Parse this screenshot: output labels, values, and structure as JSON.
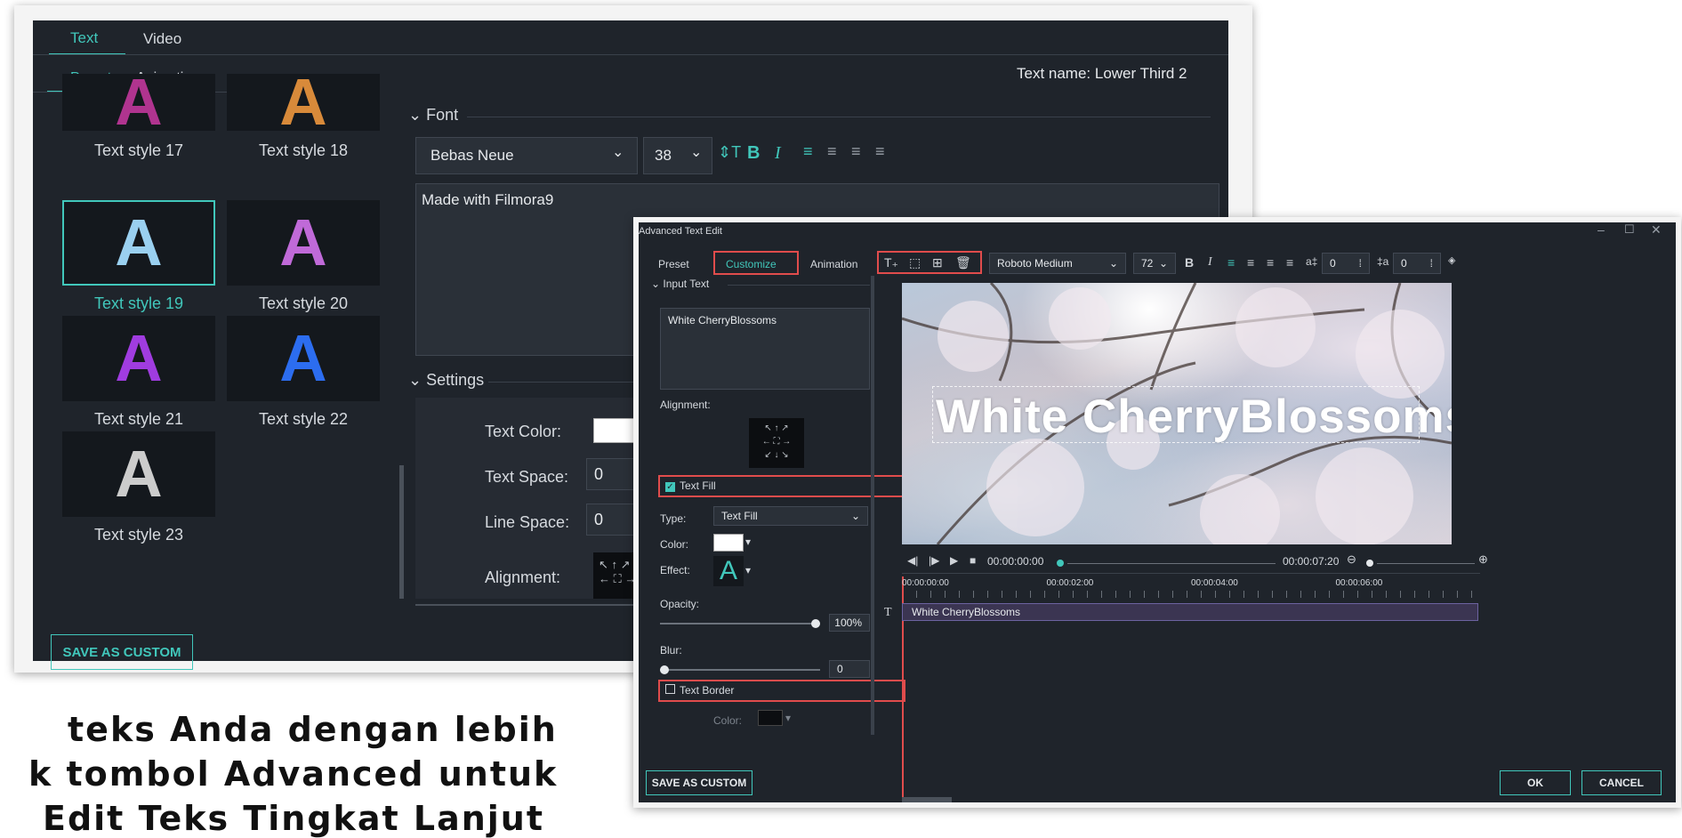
{
  "panel1": {
    "tabs": [
      "Text",
      "Video"
    ],
    "subtabs": [
      "Preset",
      "Animation"
    ],
    "text_name": "Text name: Lower Third 2",
    "styles": [
      {
        "label": "Text style 17",
        "color": "#b0348f"
      },
      {
        "label": "Text style 18",
        "color": "#d88a3a"
      },
      {
        "label": "Text style 19",
        "color": "#9ad0f0",
        "selected": true
      },
      {
        "label": "Text style 20",
        "color": "#c06ad8"
      },
      {
        "label": "Text style 21",
        "color": "#a03ce0"
      },
      {
        "label": "Text style 22",
        "color": "#2c6df0"
      },
      {
        "label": "Text style 23",
        "color": "#cccccc"
      }
    ],
    "glyph": "A",
    "font_section": "Font",
    "font_name": "Bebas Neue",
    "font_size": "38",
    "text_content": "Made with Filmora9",
    "settings_section": "Settings",
    "text_color_label": "Text Color:",
    "text_space_label": "Text Space:",
    "text_space_value": "0",
    "line_space_label": "Line Space:",
    "line_space_value": "0",
    "alignment_label": "Alignment:",
    "save_custom": "SAVE AS CUSTOM"
  },
  "panel2": {
    "title": "Advanced Text Edit",
    "tabs": [
      "Preset",
      "Customize",
      "Animation"
    ],
    "input_text_section": "Input Text",
    "input_text_value": "White CherryBlossoms",
    "alignment_label": "Alignment:",
    "text_fill_label": "Text Fill",
    "text_fill_checked": true,
    "type_label": "Type:",
    "type_value": "Text Fill",
    "color_label": "Color:",
    "effect_label": "Effect:",
    "effect_glyph": "A",
    "opacity_label": "Opacity:",
    "opacity_value": "100%",
    "opacity_level": 1.0,
    "blur_label": "Blur:",
    "blur_value": "0",
    "blur_level": 0.0,
    "text_border_label": "Text Border",
    "text_border_checked": false,
    "border_color_label": "Color:",
    "font_name": "Roboto Medium",
    "font_size": "72",
    "letter_spacing": "0",
    "line_spacing": "0",
    "video_caption": "White CherryBlossoms",
    "time_current": "00:00:00:00",
    "time_total": "00:00:07:20",
    "ruler": [
      "00:00:00:00",
      "00:00:02:00",
      "00:00:04:00",
      "00:00:06:00"
    ],
    "track_label": "White CherryBlossoms",
    "save_custom": "SAVE AS CUSTOM",
    "ok": "OK",
    "cancel": "CANCEL"
  },
  "caption": {
    "line1": "teks Anda dengan lebih",
    "line2": "k tombol Advanced untuk",
    "line3": "Edit Teks Tingkat Lanjut"
  },
  "colors": {
    "accent": "#41c7bb",
    "panel_bg": "#1f242b",
    "highlight_red": "#e04c4c"
  }
}
